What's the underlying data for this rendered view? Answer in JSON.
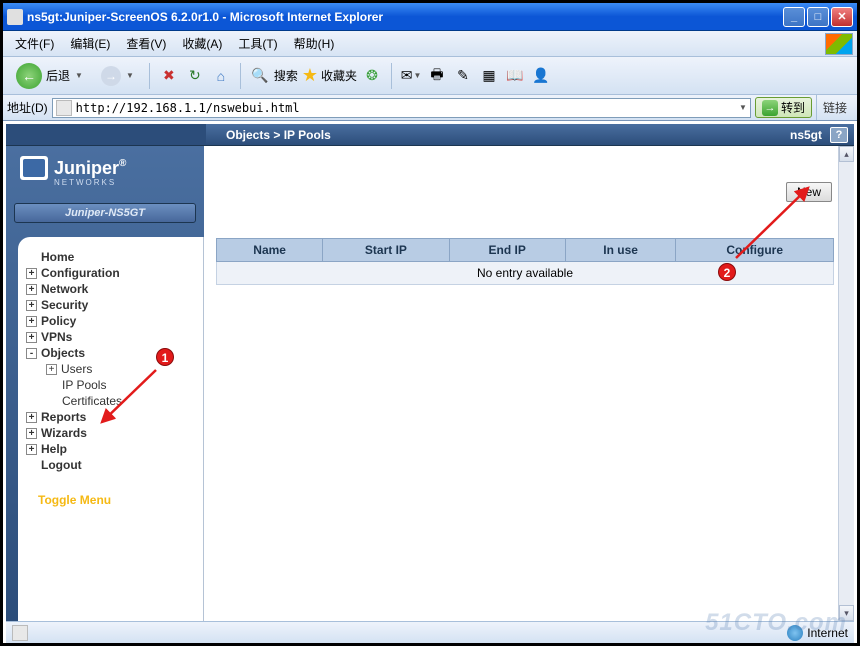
{
  "window_title": "ns5gt:Juniper-ScreenOS 6.2.0r1.0 - Microsoft Internet Explorer",
  "menus": {
    "file": "文件(F)",
    "edit": "编辑(E)",
    "view": "查看(V)",
    "favorites": "收藏(A)",
    "tools": "工具(T)",
    "help": "帮助(H)"
  },
  "toolbar": {
    "back": "后退",
    "search": "搜索",
    "favorites": "收藏夹"
  },
  "address": {
    "label": "地址(D)",
    "url": "http://192.168.1.1/nswebui.html",
    "go": "转到",
    "links": "链接"
  },
  "breadcrumb": "Objects > IP Pools",
  "host": "ns5gt",
  "logo": {
    "brand": "Juniper",
    "sub": "NETWORKS"
  },
  "device": "Juniper-NS5GT",
  "nav": {
    "home": "Home",
    "configuration": "Configuration",
    "network": "Network",
    "security": "Security",
    "policy": "Policy",
    "vpns": "VPNs",
    "objects": "Objects",
    "users": "Users",
    "ip_pools": "IP Pools",
    "certificates": "Certificates",
    "reports": "Reports",
    "wizards": "Wizards",
    "help": "Help",
    "logout": "Logout",
    "toggle": "Toggle Menu"
  },
  "buttons": {
    "new": "New"
  },
  "table": {
    "headers": {
      "name": "Name",
      "start_ip": "Start IP",
      "end_ip": "End IP",
      "in_use": "In use",
      "configure": "Configure"
    },
    "empty": "No entry available"
  },
  "status": {
    "zone": "Internet"
  },
  "watermark": "51CTO.com"
}
